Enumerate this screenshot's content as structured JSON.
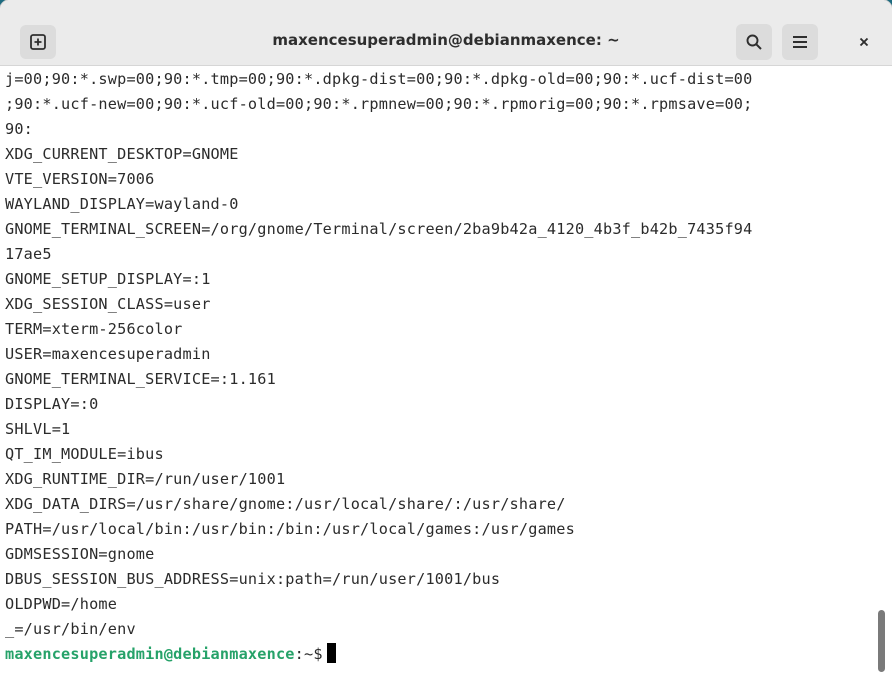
{
  "window": {
    "title": "maxencesuperadmin@debianmaxence: ~"
  },
  "icons": {
    "new_tab": "new-tab-icon",
    "search": "search-icon",
    "menu": "hamburger-menu-icon",
    "close": "close-icon"
  },
  "colors": {
    "prompt_user": "#26a269",
    "titlebar": "#ebebeb",
    "terminal_bg": "#ffffff",
    "desktop_bg": "#1d6b80"
  },
  "terminal": {
    "lines": [
      "j=00;90:*.swp=00;90:*.tmp=00;90:*.dpkg-dist=00;90:*.dpkg-old=00;90:*.ucf-dist=00",
      ";90:*.ucf-new=00;90:*.ucf-old=00;90:*.rpmnew=00;90:*.rpmorig=00;90:*.rpmsave=00;",
      "90:",
      "XDG_CURRENT_DESKTOP=GNOME",
      "VTE_VERSION=7006",
      "WAYLAND_DISPLAY=wayland-0",
      "GNOME_TERMINAL_SCREEN=/org/gnome/Terminal/screen/2ba9b42a_4120_4b3f_b42b_7435f94",
      "17ae5",
      "GNOME_SETUP_DISPLAY=:1",
      "XDG_SESSION_CLASS=user",
      "TERM=xterm-256color",
      "USER=maxencesuperadmin",
      "GNOME_TERMINAL_SERVICE=:1.161",
      "DISPLAY=:0",
      "SHLVL=1",
      "QT_IM_MODULE=ibus",
      "XDG_RUNTIME_DIR=/run/user/1001",
      "XDG_DATA_DIRS=/usr/share/gnome:/usr/local/share/:/usr/share/",
      "PATH=/usr/local/bin:/usr/bin:/bin:/usr/local/games:/usr/games",
      "GDMSESSION=gnome",
      "DBUS_SESSION_BUS_ADDRESS=unix:path=/run/user/1001/bus",
      "OLDPWD=/home",
      "_=/usr/bin/env"
    ],
    "prompt": {
      "user_host": "maxencesuperadmin@debianmaxence",
      "path": ":~$"
    }
  }
}
